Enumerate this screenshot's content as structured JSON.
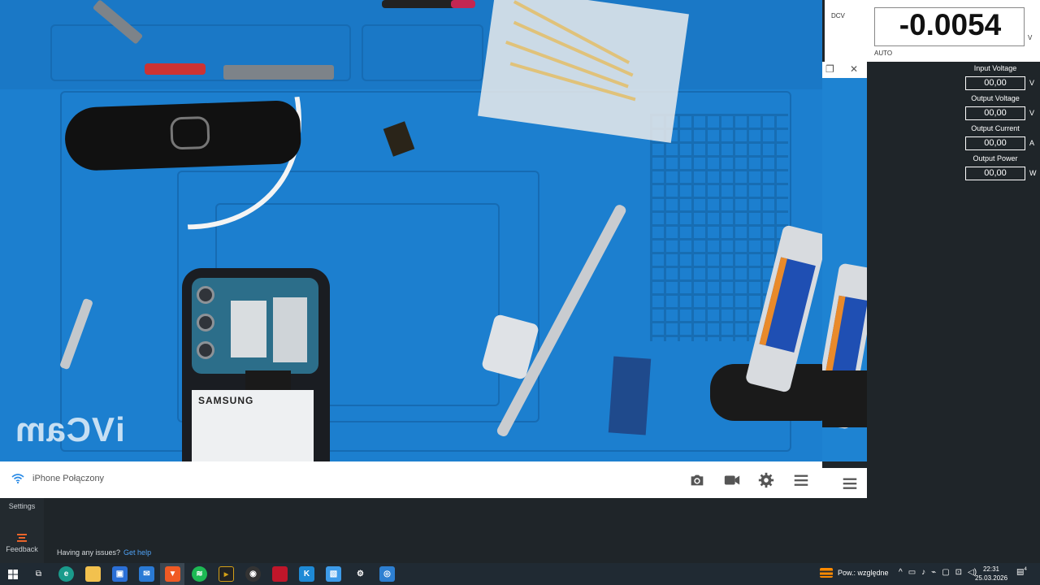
{
  "camera": {
    "status_text": "iPhone Połączony",
    "watermark": "iVCam"
  },
  "phone_label": "SAMSUNG",
  "meter": {
    "mode": "DCV",
    "value": "-0.0054",
    "unit": "V",
    "range": "AUTO"
  },
  "power_panel": {
    "rows": [
      {
        "label": "Input Voltage",
        "value": "00,00",
        "unit": "V"
      },
      {
        "label": "Output Voltage",
        "value": "00,00",
        "unit": "V"
      },
      {
        "label": "Output Current",
        "value": "00,00",
        "unit": "A"
      },
      {
        "label": "Output Power",
        "value": "00,00",
        "unit": "W"
      }
    ]
  },
  "sidebar": {
    "settings_label": "Settings",
    "feedback_label": "Feedback"
  },
  "help": {
    "text": "Having any issues?",
    "link": "Get help"
  },
  "taskbar": {
    "weather": "Pow.: względne",
    "time": "22:31",
    "date": "25.03.2026",
    "notifications": "4"
  },
  "colors": {
    "accent": "#4fa3f7",
    "mat": "#1c7fcf",
    "panel_bg": "#1f2529",
    "feedback_icon": "#ff6a2a"
  }
}
